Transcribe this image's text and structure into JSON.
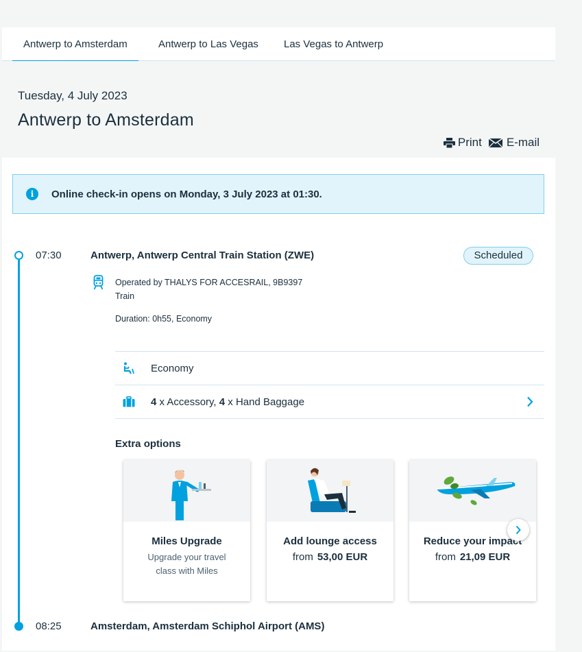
{
  "tabs": [
    {
      "label": "Antwerp to Amsterdam",
      "active": true
    },
    {
      "label": "Antwerp to Las Vegas",
      "active": false
    },
    {
      "label": "Las Vegas to Antwerp",
      "active": false
    }
  ],
  "header": {
    "date": "Tuesday, 4 July 2023",
    "title": "Antwerp to Amsterdam",
    "print_label": "Print",
    "email_label": "E-mail"
  },
  "notice": {
    "icon": "info-icon",
    "text": "Online check-in opens on Monday, 3 July 2023 at 01:30."
  },
  "departure": {
    "time": "07:30",
    "station": "Antwerp, Antwerp Central Train Station (ZWE)",
    "status": "Scheduled"
  },
  "segment": {
    "operated_by": "Operated by THALYS FOR ACCESRAIL, 9B9397",
    "mode": "Train",
    "duration": "Duration: 0h55, Economy"
  },
  "cabin": {
    "label": "Economy"
  },
  "baggage": {
    "accessory_count": "4",
    "accessory_label": " x Accessory, ",
    "hand_count": "4",
    "hand_label": " x Hand Baggage"
  },
  "extras": {
    "title": "Extra options",
    "options": [
      {
        "name": "Miles Upgrade",
        "desc": "Upgrade your travel class with Miles"
      },
      {
        "name": "Add lounge access",
        "price_label": "from",
        "price": "53,00 EUR"
      },
      {
        "name": "Reduce your impact",
        "price_label": "from",
        "price": "21,09 EUR"
      }
    ]
  },
  "arrival": {
    "time": "08:25",
    "station": "Amsterdam, Amsterdam Schiphol Airport (AMS)"
  },
  "colors": {
    "accent": "#00a1de",
    "text": "#1b2f3d",
    "notice_bg": "#e1f4fb",
    "header_bg": "#f4f6f6"
  }
}
